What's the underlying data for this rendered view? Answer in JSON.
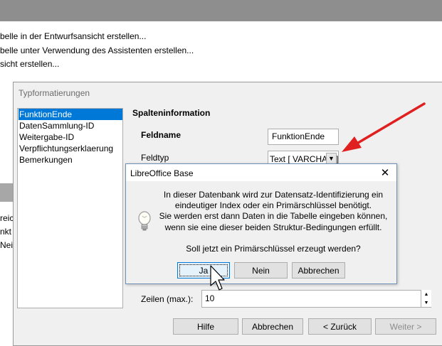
{
  "background": {
    "tasks": [
      "belle in der Entwurfsansicht erstellen...",
      "belle unter Verwendung des Assistenten erstellen...",
      "sicht erstellen..."
    ],
    "strip_texts": [
      "reic",
      "nkt",
      "Nei"
    ]
  },
  "dialog": {
    "title": "Typformatierungen",
    "fields": [
      "FunktionEnde",
      "DatenSammlung-ID",
      "Weitergabe-ID",
      "Verpflichtungserklaerung",
      "Bemerkungen"
    ],
    "selected_field": "FunktionEnde",
    "section_title": "Spalteninformation",
    "feldname_label": "Feldname",
    "feldname_value": "FunktionEnde",
    "feldtyp_label": "Feldtyp",
    "feldtyp_value": "Text [ VARCHAR ]",
    "zeilen_label": "Zeilen (max.):",
    "zeilen_value": "10",
    "buttons": {
      "hilfe": "Hilfe",
      "abbrechen": "Abbrechen",
      "zurueck": "< Zurück",
      "weiter": "Weiter >"
    }
  },
  "messagebox": {
    "title": "LibreOffice Base",
    "lines": [
      "In dieser Datenbank wird zur Datensatz-Identifizierung ein",
      "eindeutiger Index oder ein Primärschlüssel benötigt.",
      "Sie werden erst dann Daten in die Tabelle eingeben können,",
      "wenn sie eine dieser beiden Struktur-Bedingungen erfüllt."
    ],
    "question": "Soll jetzt ein Primärschlüssel erzeugt werden?",
    "buttons": {
      "ja": "Ja",
      "nein": "Nein",
      "abbrechen": "Abbrechen"
    }
  },
  "icons": {
    "close": "close-icon",
    "info": "lightbulb-icon",
    "dropdown": "chevron-down-icon",
    "spin_up": "spin-up-icon",
    "spin_down": "spin-down-icon",
    "cursor": "mouse-pointer-icon",
    "annotation": "red-arrow-icon"
  },
  "colors": {
    "selection": "#0078d7",
    "annotation_arrow": "#e02020",
    "titlebar_bg": "#8e8e8e"
  }
}
